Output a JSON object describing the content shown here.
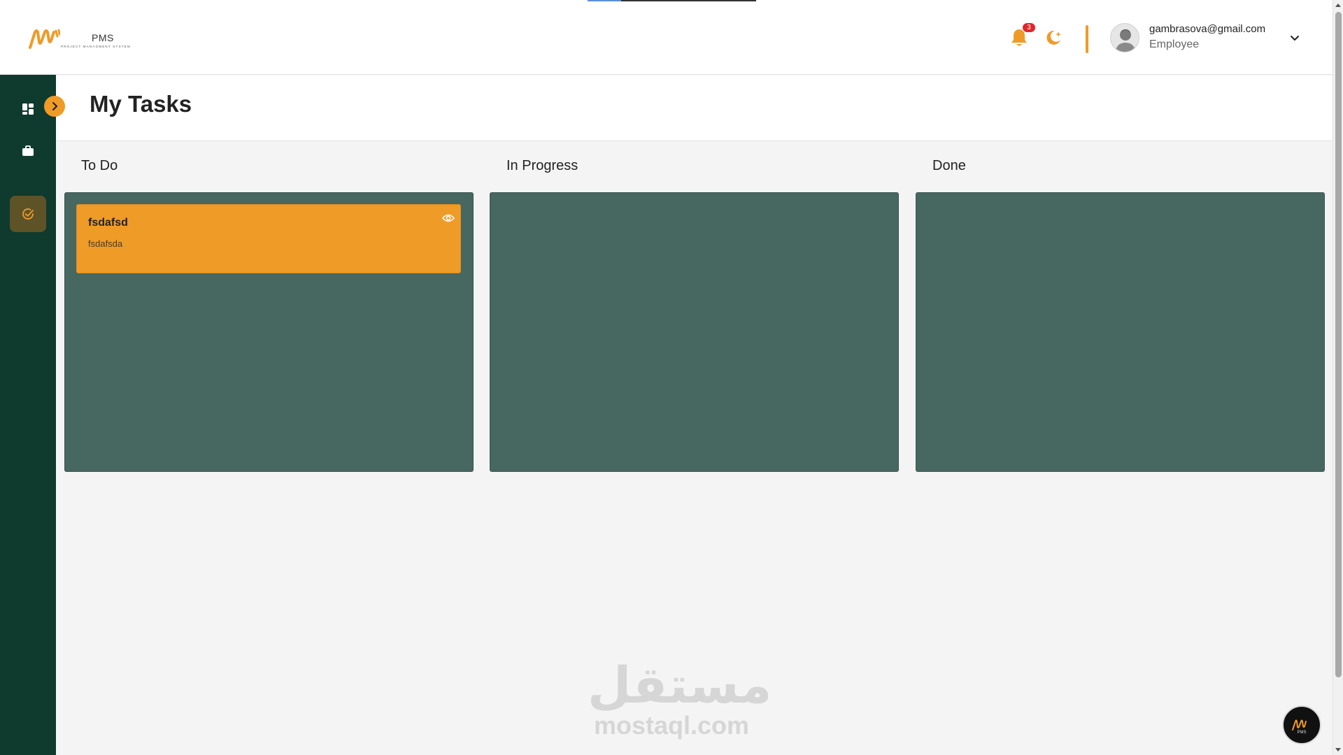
{
  "app": {
    "logo_text": "PMS",
    "logo_subtitle": "PROJECT MANAGMENT SYSTEM"
  },
  "header": {
    "notification_count": "3",
    "user_email": "gambrasova@gmail.com",
    "user_role": "Employee"
  },
  "sidebar": {
    "items": [
      {
        "icon": "dashboard-icon",
        "active": false
      },
      {
        "icon": "briefcase-icon",
        "active": false
      },
      {
        "icon": "check-circle-icon",
        "active": true
      }
    ],
    "toggle_icon": "chevron-right-icon"
  },
  "page": {
    "title": "My Tasks"
  },
  "board": {
    "columns": [
      {
        "title": "To Do"
      },
      {
        "title": "In Progress"
      },
      {
        "title": "Done"
      }
    ],
    "tasks": [
      {
        "column": "To Do",
        "title": "fsdafsd",
        "description": "fsdafsda"
      }
    ]
  },
  "watermark": {
    "arabic": "مستقل",
    "latin": "mostaql.com"
  },
  "fab": {
    "label": "PMS"
  },
  "colors": {
    "accent": "#ef9b28",
    "sidebar_bg": "#0f3a2e",
    "column_bg": "#476761",
    "badge": "#e0272c",
    "active_item": "#5d5327"
  }
}
